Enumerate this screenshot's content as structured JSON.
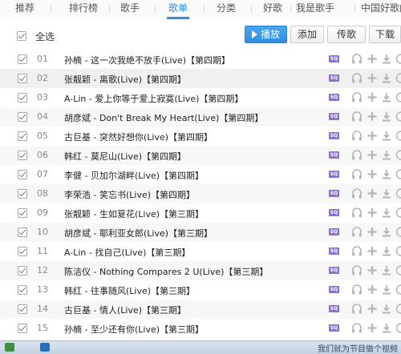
{
  "tabs": [
    "推荐",
    "排行榜",
    "歌手",
    "歌单",
    "分类",
    "好歌",
    "我是歌手",
    "中国好歌曲"
  ],
  "active_tab": "歌单",
  "toolbar": {
    "select_all": "全选",
    "play": "播放",
    "add": "添加",
    "share": "传歌",
    "download": "下载"
  },
  "songs": [
    {
      "num": "01",
      "title": "孙楠 - 这一次我绝不放手(Live)【第四期】"
    },
    {
      "num": "02",
      "title": "张靓颖 - 离歌(Live)【第四期】"
    },
    {
      "num": "03",
      "title": "A-Lin - 爱上你等于爱上寂寞(Live)【第四期】"
    },
    {
      "num": "04",
      "title": "胡彦斌 - Don't Break My Heart(Live)【第四期】"
    },
    {
      "num": "05",
      "title": "古巨基 - 突然好想你(Live)【第四期】"
    },
    {
      "num": "06",
      "title": "韩红 - 莫尼山(Live)【第四期】"
    },
    {
      "num": "07",
      "title": "李健 - 贝加尔湖畔(Live)【第四期】"
    },
    {
      "num": "08",
      "title": "李荣浩 - 笑忘书(Live)【第四期】"
    },
    {
      "num": "09",
      "title": "张靓颖 - 生如夏花(Live)【第三期】"
    },
    {
      "num": "10",
      "title": "胡彦斌 - 耶利亚女郎(Live)【第三期】"
    },
    {
      "num": "11",
      "title": "A-Lin - 找自己(Live)【第三期】"
    },
    {
      "num": "12",
      "title": "陈洁仪 - Nothing Compares 2 U(Live)【第三期】"
    },
    {
      "num": "13",
      "title": "韩红 - 往事随风(Live)【第三期】"
    },
    {
      "num": "14",
      "title": "古巨基 - 情人(Live)【第三期】"
    },
    {
      "num": "15",
      "title": "孙楠 - 至少还有你(Live)【第三期】"
    }
  ],
  "quality_badge": "SQ",
  "row_actions": [
    "headphones-icon",
    "plus-icon",
    "download-icon",
    "more-icon"
  ],
  "taskbar_text": "我们就为节目做个视频",
  "colors": {
    "accent": "#2f8ee4",
    "sq_badge": "#8a6fd1",
    "icon_gray": "#b4b4b4"
  }
}
